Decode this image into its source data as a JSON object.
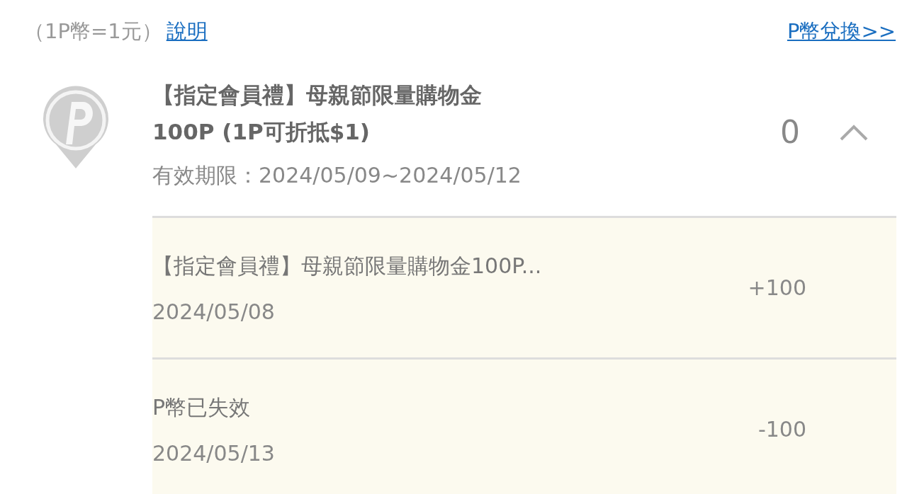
{
  "header": {
    "rate": "（1P幣=1元）",
    "help_link": "說明",
    "exchange_link": "P幣兌換>>"
  },
  "points": {
    "title_lines": [
      "【指定會員禮】母親節限量購物金",
      "100P (1P可折抵$1)"
    ],
    "validity": "有效期限：2024/05/09~2024/05/12",
    "balance": "0",
    "expanded": true
  },
  "records": [
    {
      "description": "【指定會員禮】母親節限量購物金100P...",
      "date": "2024/05/08",
      "amount": "+100"
    },
    {
      "description": "P幣已失效",
      "date": "2024/05/13",
      "amount": "-100"
    }
  ]
}
